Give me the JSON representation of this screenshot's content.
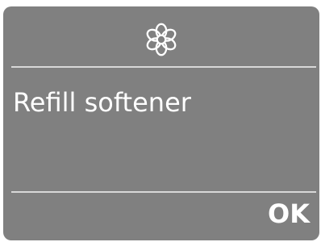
{
  "screen": {
    "icon": "flower-softener-icon",
    "message": "Refill softener",
    "ok_label": "OK"
  },
  "colors": {
    "panel_background": "#808080",
    "divider": "#d8d8d8",
    "text": "#ffffff"
  }
}
